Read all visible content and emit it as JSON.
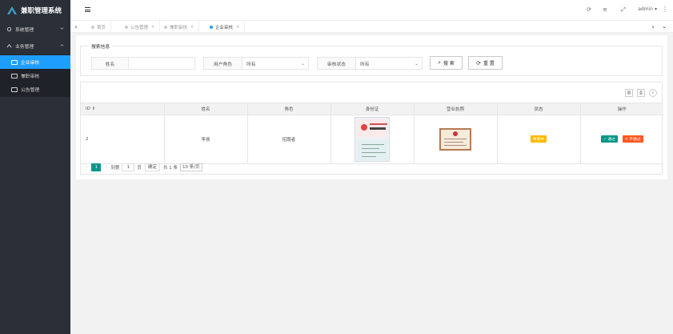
{
  "app": {
    "title": "兼职管理系统"
  },
  "sidebar": {
    "groups": [
      {
        "label": "系统管理",
        "expanded": false
      },
      {
        "label": "业务管理",
        "expanded": true,
        "items": [
          {
            "label": "企业审核",
            "active": true
          },
          {
            "label": "兼职审核",
            "active": false
          },
          {
            "label": "公告管理",
            "active": false
          }
        ]
      }
    ]
  },
  "header": {
    "user": "admin",
    "user_caret": "▾"
  },
  "tabs": [
    {
      "label": "首页",
      "closable": false
    },
    {
      "label": "公告管理",
      "closable": true
    },
    {
      "label": "兼职审核",
      "closable": true
    },
    {
      "label": "企业审核",
      "closable": true,
      "active": true
    }
  ],
  "search": {
    "legend": "搜索信息",
    "name_label": "姓名",
    "name_value": "",
    "role_label": "用户角色",
    "role_value": "所有",
    "status_label": "审核状态",
    "status_value": "所有",
    "search_button": "搜 索",
    "reset_button": "重 置"
  },
  "table": {
    "columns": [
      "ID ⇕",
      "姓名",
      "角色",
      "身份证",
      "营业执照",
      "状态",
      "操作"
    ],
    "rows": [
      {
        "id": "2",
        "name": "李扬",
        "role": "招聘者",
        "status": "审核中",
        "pass": "✓ 通过",
        "fail": "✕ 不通过"
      }
    ]
  },
  "pager": {
    "prev": "‹",
    "current": "1",
    "next": "›",
    "goto_prefix": "到第",
    "goto_value": "1",
    "goto_suffix": "页",
    "confirm": "确定",
    "total": "共 1 条",
    "page_size": "10 条/页"
  },
  "colors": {
    "sidebar": "#2b3038",
    "accent": "#1e9fff",
    "primary": "#009688",
    "warn": "#ffb800",
    "danger": "#ff5722"
  }
}
